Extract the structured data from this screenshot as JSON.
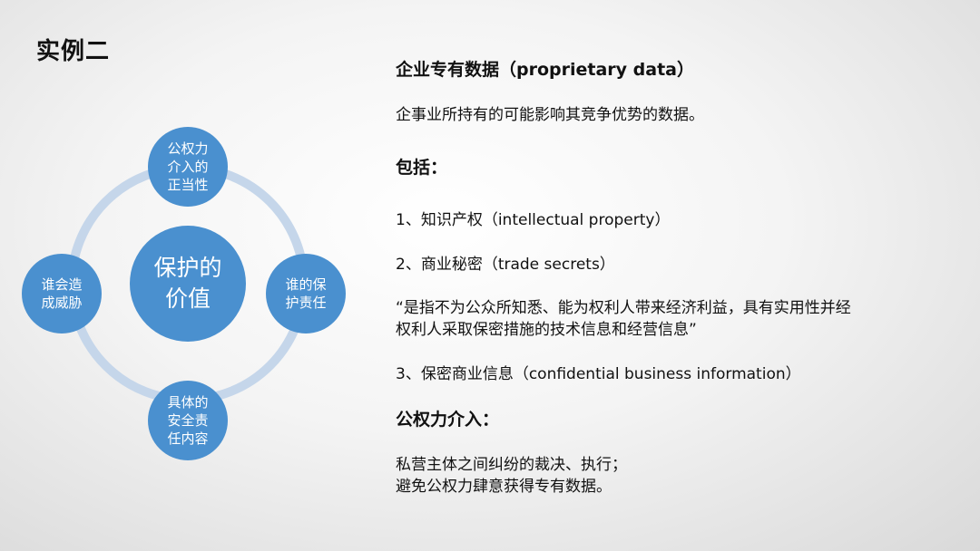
{
  "title": "实例二",
  "diagram": {
    "center": "保护的\n价值",
    "nodes": {
      "top": "公权力\n介入的\n正当性",
      "right": "谁的保\n护责任",
      "bottom": "具体的\n安全责\n任内容",
      "left": "谁会造\n成威胁"
    },
    "colors": {
      "node": "#4a90cf",
      "ring": "#c5d6ea"
    }
  },
  "panel": {
    "heading1": "企业专有数据（proprietary data）",
    "definition": "企事业所持有的可能影响其竞争优势的数据。",
    "heading2": "包括：",
    "item1": "1、知识产权（intellectual property）",
    "item2": "2、商业秘密（trade secrets）",
    "quote_line1": "“是指不为公众所知悉、能为权利人带来经济利益，具有实用性并经",
    "quote_line2": "权利人采取保密措施的技术信息和经营信息”",
    "item3": "3、保密商业信息（confidential business information）",
    "heading3": "公权力介入：",
    "note_line1": "私营主体之间纠纷的裁决、执行；",
    "note_line2": "避免公权力肆意获得专有数据。"
  }
}
